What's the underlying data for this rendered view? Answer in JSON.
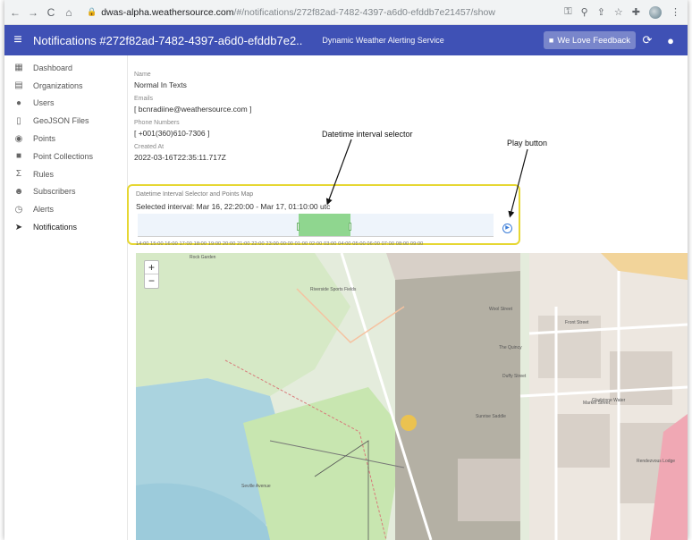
{
  "browser": {
    "url_host": "dwas-alpha.weathersource.com",
    "url_path": "/#/notifications/272f82ad-7482-4397-a6d0-efddb7e21457/show"
  },
  "appbar": {
    "title": "Notifications #272f82ad-7482-4397-a6d0-efddb7e2..",
    "subtitle": "Dynamic Weather Alerting Service",
    "feedback_label": "We Love Feedback",
    "brand_color": "#3f51b5"
  },
  "sidebar": {
    "items": [
      {
        "label": "Dashboard",
        "icon": "dashboard-icon"
      },
      {
        "label": "Organizations",
        "icon": "organizations-icon"
      },
      {
        "label": "Users",
        "icon": "users-icon"
      },
      {
        "label": "GeoJSON Files",
        "icon": "file-icon"
      },
      {
        "label": "Points",
        "icon": "pin-icon"
      },
      {
        "label": "Point Collections",
        "icon": "collection-icon"
      },
      {
        "label": "Rules",
        "icon": "sigma-icon"
      },
      {
        "label": "Subscribers",
        "icon": "subscribers-icon"
      },
      {
        "label": "Alerts",
        "icon": "alarm-icon"
      },
      {
        "label": "Notifications",
        "icon": "send-icon"
      }
    ]
  },
  "details": {
    "fields": [
      {
        "label": "Name",
        "value": "Normal In Texts"
      },
      {
        "label": "Emails",
        "value": "[ bcnradiine@weathersource.com ]"
      },
      {
        "label": "Phone Numbers",
        "value": "[ +001(360)610-7306 ]"
      },
      {
        "label": "Created At",
        "value": "2022-03-16T22:35:11.717Z"
      }
    ]
  },
  "selector": {
    "title": "Datetime Interval Selector and Points Map",
    "interval_text": "Selected interval: Mar 16, 22:20:00 - Mar 17, 01:10:00 utc",
    "tick_labels": "14:00 15:00 16:00 17:00 18:00 19:00 20:00 21:00 22:00 23:00 00:00 01:00 02:00 03:00 04:00 05:00 06:00 07:00 08:00 09:00"
  },
  "annotations": {
    "selector_label": "Datetime interval selector",
    "play_label": "Play button"
  },
  "map": {
    "labels": [
      "Rock Garden",
      "Riverside Sports Fields",
      "Wool Street",
      "Front Street",
      "The Quincy",
      "Duffy Street",
      "Sunrise Saddle",
      "Market Street",
      "Gladstone Water",
      "Seville Avenue",
      "Rendezvous Lodge"
    ]
  }
}
